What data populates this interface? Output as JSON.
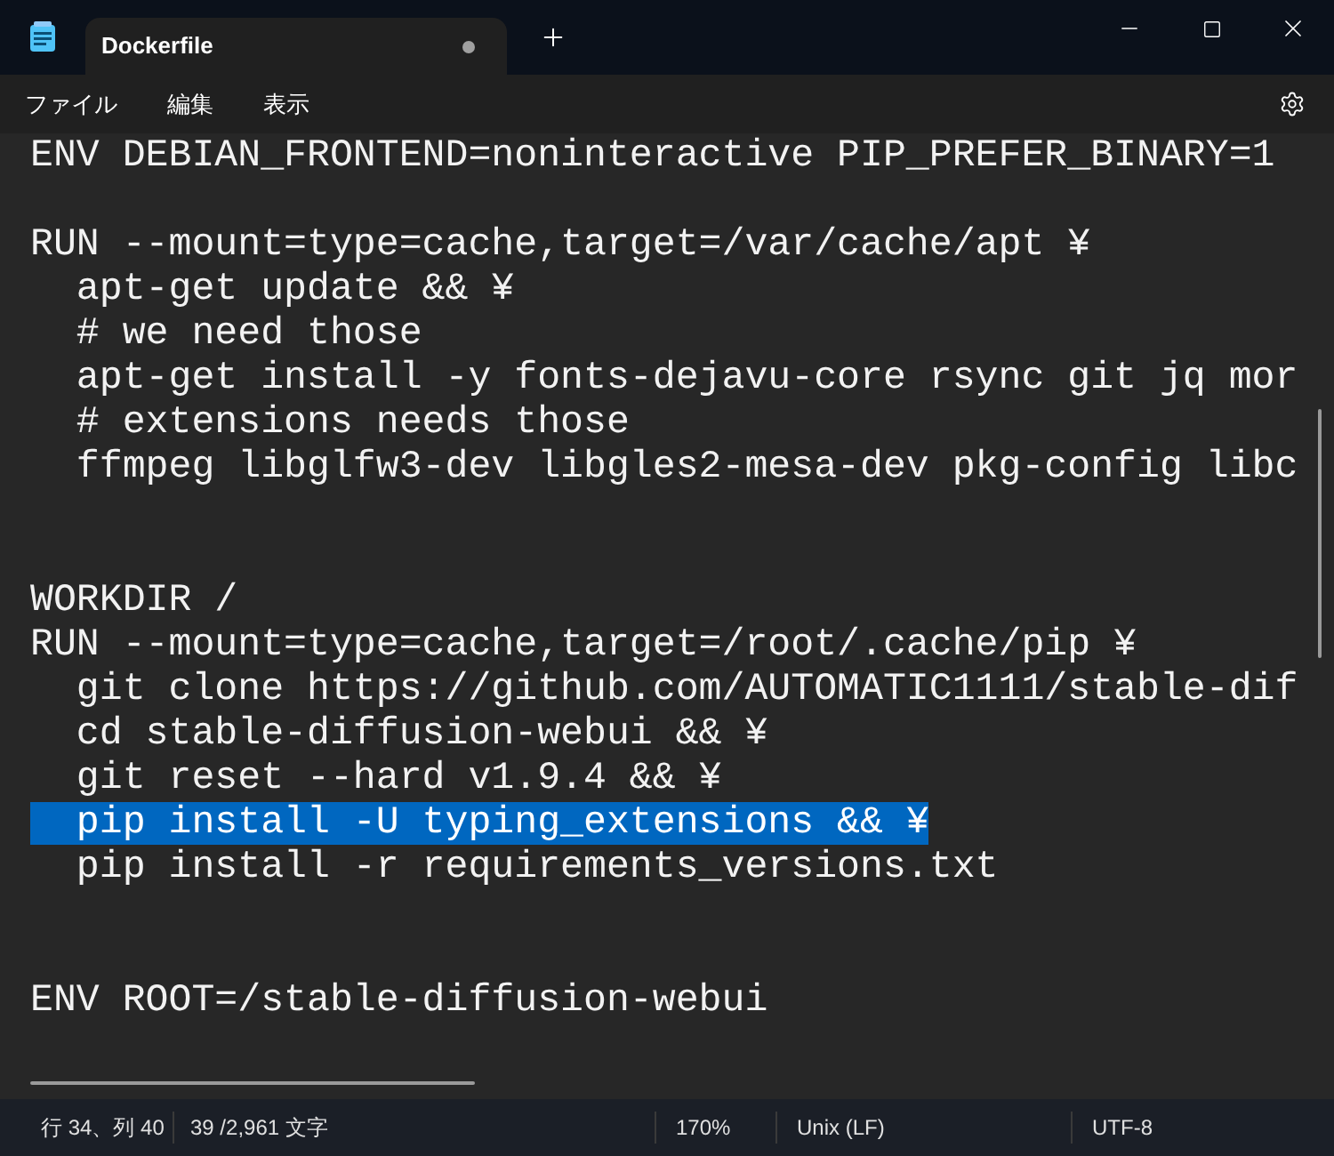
{
  "window": {
    "tab": {
      "title": "Dockerfile",
      "modified": true
    }
  },
  "menu": [
    "ファイル",
    "編集",
    "表示"
  ],
  "editor": {
    "sections": [
      {
        "kind": "single-gap",
        "lines": [
          {
            "text": "ENV DEBIAN_FRONTEND=noninteractive PIP_PREFER_BINARY=1",
            "selected": false
          }
        ]
      },
      {
        "kind": "double-gap",
        "lines": [
          {
            "text": "RUN --mount=type=cache,target=/var/cache/apt ¥",
            "selected": false
          },
          {
            "text": "  apt-get update && ¥",
            "selected": false
          },
          {
            "text": "  # we need those",
            "selected": false
          },
          {
            "text": "  apt-get install -y fonts-dejavu-core rsync git jq mor",
            "selected": false
          },
          {
            "text": "  # extensions needs those",
            "selected": false
          },
          {
            "text": "  ffmpeg libglfw3-dev libgles2-mesa-dev pkg-config libc",
            "selected": false
          }
        ]
      },
      {
        "kind": "double-gap",
        "lines": [
          {
            "text": "WORKDIR /",
            "selected": false
          },
          {
            "text": "RUN --mount=type=cache,target=/root/.cache/pip ¥",
            "selected": false
          },
          {
            "text": "  git clone https://github.com/AUTOMATIC1111/stable-dif",
            "selected": false
          },
          {
            "text": "  cd stable-diffusion-webui && ¥",
            "selected": false
          },
          {
            "text": "  git reset --hard v1.9.4 && ¥",
            "selected": false
          },
          {
            "text": "  pip install -U typing_extensions && ¥",
            "selected": true
          },
          {
            "text": "  pip install -r requirements_versions.txt",
            "selected": false
          }
        ]
      },
      {
        "kind": "no-gap",
        "lines": [
          {
            "text": "ENV ROOT=/stable-diffusion-webui",
            "selected": false
          }
        ]
      }
    ]
  },
  "status_bar": {
    "position": "行 34、列 40",
    "count": "39 /2,961 文字",
    "zoom": "170%",
    "line_ending": "Unix (LF)",
    "encoding": "UTF-8"
  }
}
